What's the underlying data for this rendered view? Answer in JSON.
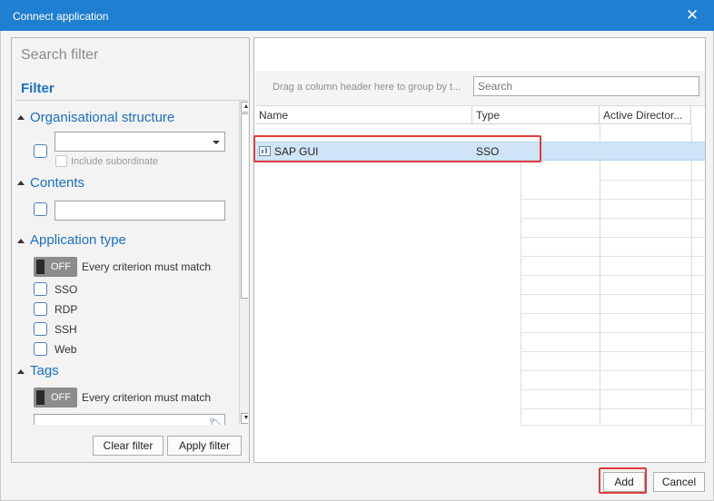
{
  "window": {
    "title": "Connect application",
    "close_glyph": "✕"
  },
  "filter_panel": {
    "search_placeholder": "Search filter",
    "heading": "Filter",
    "sections": {
      "org": {
        "title": "Organisational structure",
        "include_subordinate": "Include subordinate"
      },
      "contents": {
        "title": "Contents"
      },
      "app_type": {
        "title": "Application type",
        "toggle_state": "OFF",
        "toggle_label": "Every criterion must match",
        "options": [
          "SSO",
          "RDP",
          "SSH",
          "Web"
        ]
      },
      "tags": {
        "title": "Tags",
        "toggle_state": "OFF",
        "toggle_label": "Every criterion must match"
      }
    },
    "buttons": {
      "clear": "Clear filter",
      "apply": "Apply filter"
    }
  },
  "grid": {
    "group_hint": "Drag a column header here to group by t...",
    "search_placeholder": "Search",
    "columns": [
      "Name",
      "Type",
      "Active Director..."
    ],
    "rows": [
      {
        "name": "SAP GUI",
        "type": "SSO",
        "active_directory": ""
      }
    ]
  },
  "footer": {
    "add": "Add",
    "cancel": "Cancel"
  },
  "colors": {
    "titlebar": "#1f7fd1",
    "accent_text": "#1a6fc0",
    "selection": "#cfe4f6",
    "highlight": "#e23b3b"
  }
}
